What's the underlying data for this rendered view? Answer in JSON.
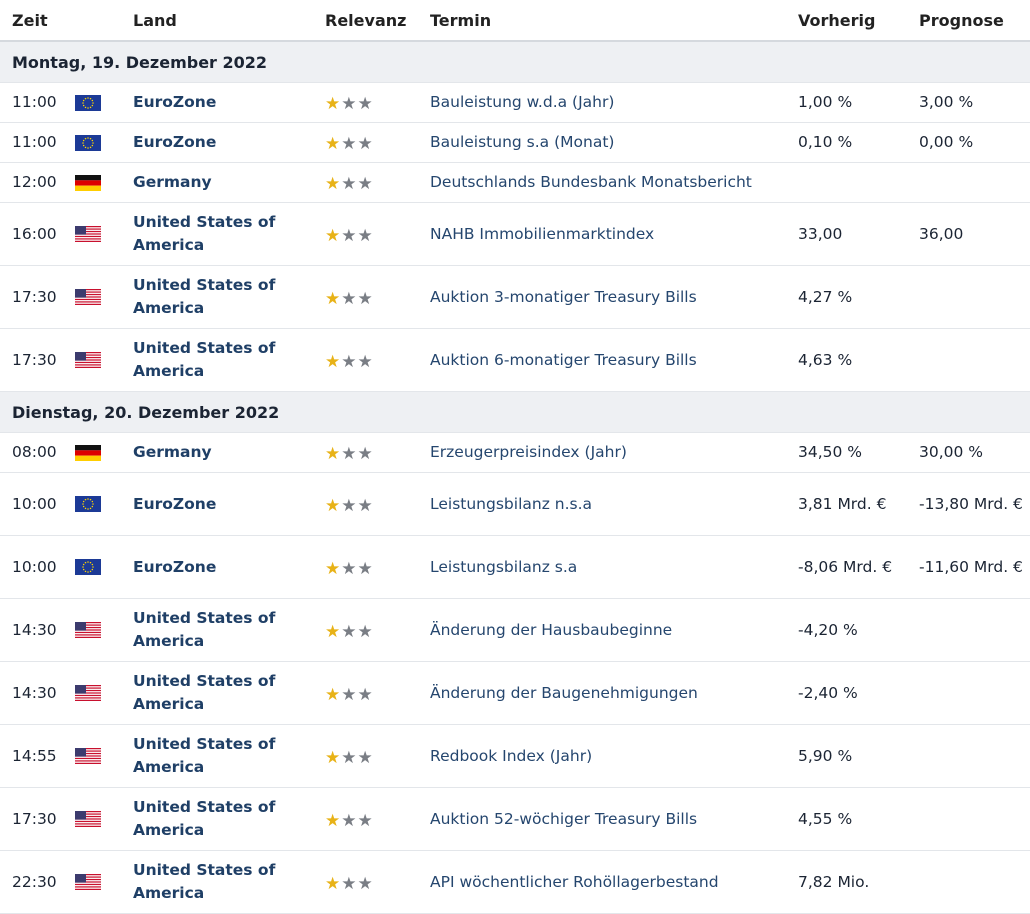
{
  "columns": {
    "time": "Zeit",
    "country": "Land",
    "relevance": "Relevanz",
    "event": "Termin",
    "previous": "Vorherig",
    "forecast": "Prognose"
  },
  "colors": {
    "star_active": "#e8b217",
    "star_inactive": "#7a7e85",
    "link": "#1f3f66"
  },
  "days": [
    {
      "label": "Montag, 19. Dezember 2022",
      "rows": [
        {
          "time": "11:00",
          "flag": "eu-flag",
          "country": "EuroZone",
          "relevance": 1,
          "event": "Bauleistung w.d.a (Jahr)",
          "previous": "1,00 %",
          "forecast": "3,00 %"
        },
        {
          "time": "11:00",
          "flag": "eu-flag",
          "country": "EuroZone",
          "relevance": 1,
          "event": "Bauleistung s.a (Monat)",
          "previous": "0,10 %",
          "forecast": "0,00 %"
        },
        {
          "time": "12:00",
          "flag": "de-flag",
          "country": "Germany",
          "relevance": 1,
          "event": "Deutschlands Bundesbank Monatsbericht",
          "previous": "",
          "forecast": ""
        },
        {
          "time": "16:00",
          "flag": "us-flag",
          "country": "United States of America",
          "relevance": 1,
          "event": "NAHB Immobilienmarktindex",
          "previous": "33,00",
          "forecast": "36,00"
        },
        {
          "time": "17:30",
          "flag": "us-flag",
          "country": "United States of America",
          "relevance": 1,
          "event": "Auktion 3-monatiger Treasury Bills",
          "previous": "4,27 %",
          "forecast": ""
        },
        {
          "time": "17:30",
          "flag": "us-flag",
          "country": "United States of America",
          "relevance": 1,
          "event": "Auktion 6-monatiger Treasury Bills",
          "previous": "4,63 %",
          "forecast": ""
        }
      ]
    },
    {
      "label": "Dienstag, 20. Dezember 2022",
      "rows": [
        {
          "time": "08:00",
          "flag": "de-flag",
          "country": "Germany",
          "relevance": 1,
          "event": "Erzeugerpreisindex (Jahr)",
          "previous": "34,50 %",
          "forecast": "30,00 %"
        },
        {
          "time": "10:00",
          "flag": "eu-flag",
          "country": "EuroZone",
          "relevance": 1,
          "event": "Leistungsbilanz n.s.a",
          "previous": "3,81 Mrd. €",
          "forecast": "-13,80 Mrd. €"
        },
        {
          "time": "10:00",
          "flag": "eu-flag",
          "country": "EuroZone",
          "relevance": 1,
          "event": "Leistungsbilanz s.a",
          "previous": "-8,06 Mrd. €",
          "forecast": "-11,60 Mrd. €"
        },
        {
          "time": "14:30",
          "flag": "us-flag",
          "country": "United States of America",
          "relevance": 1,
          "event": "Änderung der Hausbaubeginne",
          "previous": "-4,20 %",
          "forecast": ""
        },
        {
          "time": "14:30",
          "flag": "us-flag",
          "country": "United States of America",
          "relevance": 1,
          "event": "Änderung der Baugenehmigungen",
          "previous": "-2,40 %",
          "forecast": ""
        },
        {
          "time": "14:55",
          "flag": "us-flag",
          "country": "United States of America",
          "relevance": 1,
          "event": "Redbook Index (Jahr)",
          "previous": "5,90 %",
          "forecast": ""
        },
        {
          "time": "17:30",
          "flag": "us-flag",
          "country": "United States of America",
          "relevance": 1,
          "event": "Auktion 52-wöchiger Treasury Bills",
          "previous": "4,55 %",
          "forecast": ""
        },
        {
          "time": "22:30",
          "flag": "us-flag",
          "country": "United States of America",
          "relevance": 1,
          "event": "API wöchentlicher Rohöllagerbestand",
          "previous": "7,82 Mio.",
          "forecast": ""
        }
      ]
    }
  ]
}
